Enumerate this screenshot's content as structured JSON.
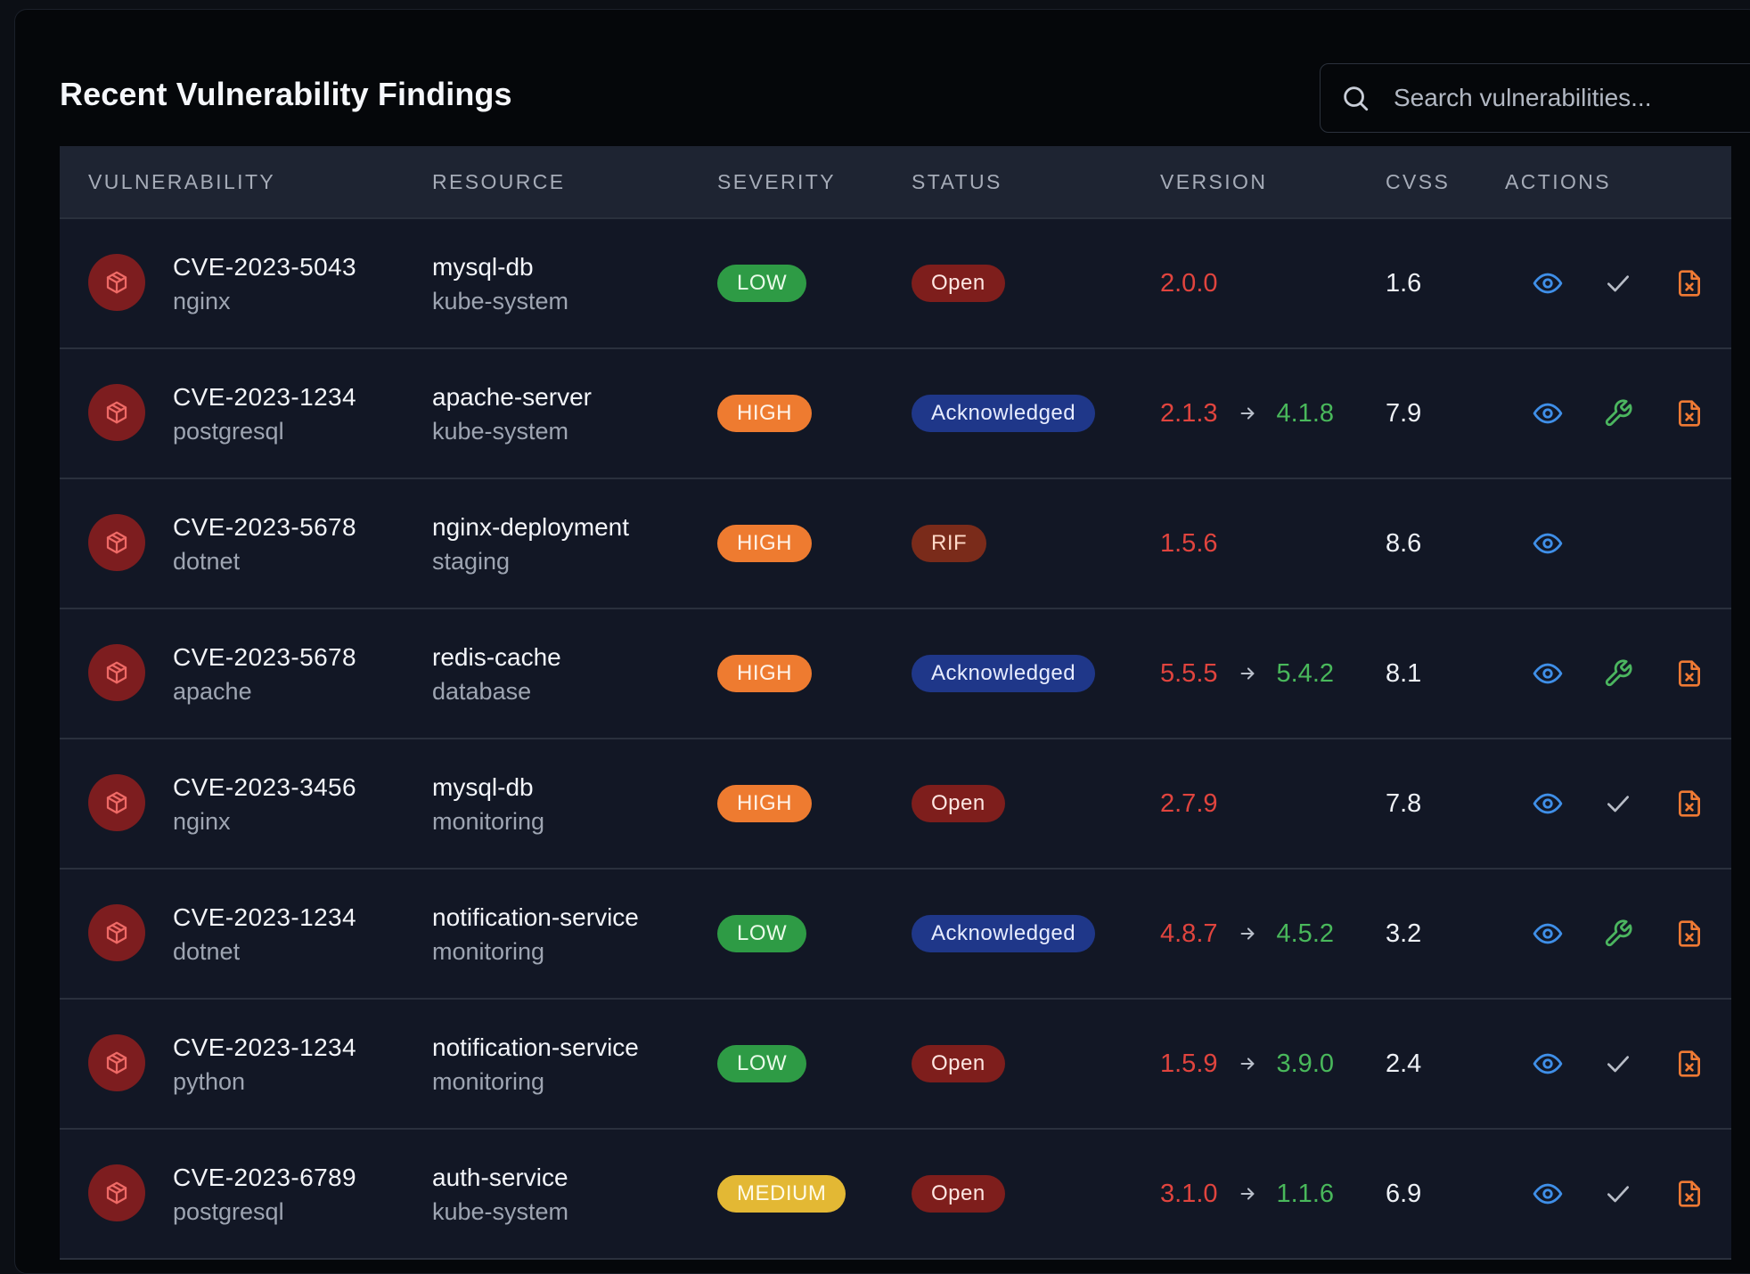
{
  "header": {
    "title": "Recent Vulnerability Findings",
    "search_placeholder": "Search vulnerabilities..."
  },
  "columns": [
    "Vulnerability",
    "Resource",
    "Severity",
    "Status",
    "Version",
    "CVSS",
    "Actions"
  ],
  "icons": {
    "search": "search-icon",
    "vulnerability": "package-icon",
    "view": "eye-icon",
    "acknowledge": "check-icon",
    "fix": "wrench-icon",
    "dismiss": "file-x-icon",
    "arrow": "arrow-right-icon"
  },
  "colors": {
    "low": "#2e9b45",
    "medium": "#e3b834",
    "high": "#ee7b30",
    "open": "#7e1e1c",
    "acknowledged": "#1f3789",
    "rif": "#7a2b1a",
    "version_from": "#e0443e",
    "version_to": "#49b85b",
    "view_icon": "#3f8fe8",
    "fix_icon": "#4bb55f",
    "dismiss_icon": "#ef7a34"
  },
  "rows": [
    {
      "cve": "CVE-2023-5043",
      "package": "nginx",
      "resource": "mysql-db",
      "namespace": "kube-system",
      "severity": "LOW",
      "status": "Open",
      "version_from": "2.0.0",
      "version_to": "",
      "cvss": "1.6",
      "actions": [
        "view",
        "acknowledge",
        "dismiss"
      ]
    },
    {
      "cve": "CVE-2023-1234",
      "package": "postgresql",
      "resource": "apache-server",
      "namespace": "kube-system",
      "severity": "HIGH",
      "status": "Acknowledged",
      "version_from": "2.1.3",
      "version_to": "4.1.8",
      "cvss": "7.9",
      "actions": [
        "view",
        "fix",
        "dismiss"
      ]
    },
    {
      "cve": "CVE-2023-5678",
      "package": "dotnet",
      "resource": "nginx-deployment",
      "namespace": "staging",
      "severity": "HIGH",
      "status": "RIF",
      "version_from": "1.5.6",
      "version_to": "",
      "cvss": "8.6",
      "actions": [
        "view"
      ]
    },
    {
      "cve": "CVE-2023-5678",
      "package": "apache",
      "resource": "redis-cache",
      "namespace": "database",
      "severity": "HIGH",
      "status": "Acknowledged",
      "version_from": "5.5.5",
      "version_to": "5.4.2",
      "cvss": "8.1",
      "actions": [
        "view",
        "fix",
        "dismiss"
      ]
    },
    {
      "cve": "CVE-2023-3456",
      "package": "nginx",
      "resource": "mysql-db",
      "namespace": "monitoring",
      "severity": "HIGH",
      "status": "Open",
      "version_from": "2.7.9",
      "version_to": "",
      "cvss": "7.8",
      "actions": [
        "view",
        "acknowledge",
        "dismiss"
      ]
    },
    {
      "cve": "CVE-2023-1234",
      "package": "dotnet",
      "resource": "notification-service",
      "namespace": "monitoring",
      "severity": "LOW",
      "status": "Acknowledged",
      "version_from": "4.8.7",
      "version_to": "4.5.2",
      "cvss": "3.2",
      "actions": [
        "view",
        "fix",
        "dismiss"
      ]
    },
    {
      "cve": "CVE-2023-1234",
      "package": "python",
      "resource": "notification-service",
      "namespace": "monitoring",
      "severity": "LOW",
      "status": "Open",
      "version_from": "1.5.9",
      "version_to": "3.9.0",
      "cvss": "2.4",
      "actions": [
        "view",
        "acknowledge",
        "dismiss"
      ]
    },
    {
      "cve": "CVE-2023-6789",
      "package": "postgresql",
      "resource": "auth-service",
      "namespace": "kube-system",
      "severity": "MEDIUM",
      "status": "Open",
      "version_from": "3.1.0",
      "version_to": "1.1.6",
      "cvss": "6.9",
      "actions": [
        "view",
        "acknowledge",
        "dismiss"
      ]
    }
  ]
}
